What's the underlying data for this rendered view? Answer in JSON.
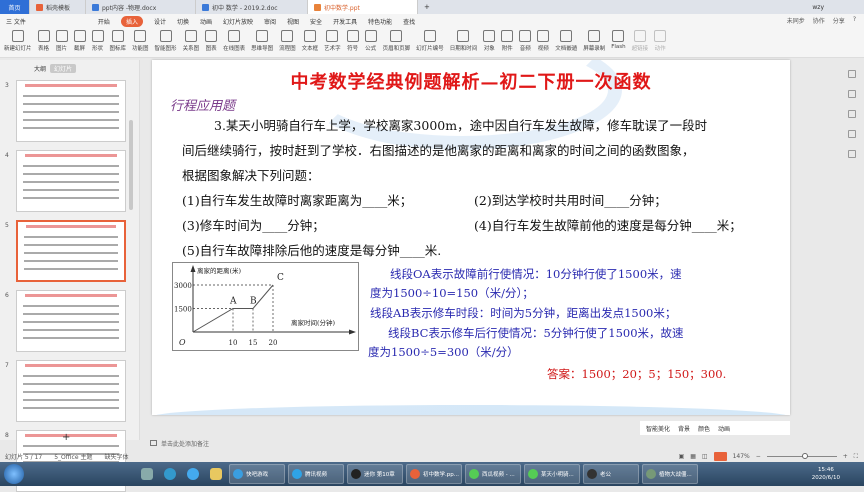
{
  "tabs": [
    {
      "label": "首页"
    },
    {
      "label": "稻壳模板"
    },
    {
      "label": "ppt内容 -物理.docx"
    },
    {
      "label": "初中 数学 - 2019.2.doc"
    },
    {
      "label": "初中数学.ppt",
      "active": true
    }
  ],
  "user": "wzy",
  "menu": [
    "三 文件",
    "开始",
    "插入",
    "设计",
    "切换",
    "动画",
    "幻灯片放映",
    "审阅",
    "视图",
    "安全",
    "开发工具",
    "特色功能",
    "查找"
  ],
  "menu_selected": "插入",
  "menu_right": [
    "未同步",
    "协作",
    "分享",
    "?"
  ],
  "ribbon": [
    "新建幻灯片",
    "表格",
    "图片",
    "截屏",
    "形状",
    "图标库",
    "功能图",
    "智能图形",
    "关系图",
    "图表",
    "在线图表",
    "思维导图",
    "流程图",
    "文本框",
    "艺术字",
    "符号",
    "公式",
    "页眉和页脚",
    "幻灯片编号",
    "日期和时间",
    "对象",
    "附件",
    "音频",
    "视频",
    "文档嵌遁",
    "屏幕录制",
    "Flash",
    "超链接",
    "动作"
  ],
  "left_panel": {
    "tabs": [
      "大纲",
      "幻灯片"
    ],
    "slide_numbers": [
      "3",
      "4",
      "5",
      "6",
      "7",
      "8"
    ],
    "current": "5",
    "add_label": "+"
  },
  "slide": {
    "title": "中考数学经典例题解析—初二下册一次函数",
    "subtitle": "行程应用题",
    "lines": [
      "3.某天小明骑自行车上学，学校离家3000m，途中因自行车发生故障，修车耽误了一段时",
      "间后继续骑行，按时赶到了学校．右图描述的是他离家的距离和离家的时间之间的函数图象，",
      "根据图象解决下列问题："
    ],
    "q1": "(1)自行车发生故障时离家距离为____米；",
    "q2": "(2)到达学校时共用时间____分钟；",
    "q3": "(3)修车时间为____分钟；",
    "q4": "(4)自行车发生故障前他的速度是每分钟____米；",
    "q5": "(5)自行车故障排除后他的速度是每分钟____米.",
    "explain": [
      "线段OA表示故障前行使情况：10分钟行使了1500米，速",
      "度为1500÷10=150（米/分）；",
      "线段AB表示修车时段：时间为5分钟，距离出发点1500米；",
      "线段BC表示修车后行使情况：5分钟行使了1500米，故速",
      "度为1500÷5=300（米/分）"
    ],
    "answer": "答案：1500；20；5；150；300."
  },
  "chart_data": {
    "type": "line",
    "ylabel": "离家的距离(米)",
    "xlabel": "离家时间(分钟)",
    "origin_label": "O",
    "x_ticks": [
      "10",
      "15",
      "20"
    ],
    "y_ticks": [
      "1500",
      "3000"
    ],
    "points": [
      {
        "label": "",
        "x": 0,
        "y": 0
      },
      {
        "label": "A",
        "x": 10,
        "y": 1500
      },
      {
        "label": "B",
        "x": 15,
        "y": 1500
      },
      {
        "label": "C",
        "x": 20,
        "y": 3000
      }
    ]
  },
  "slide_tools": [
    "智能美化",
    "背景",
    "颜色",
    "动画"
  ],
  "notes_placeholder": "单击此处添加备注",
  "status": {
    "slide": "幻灯片 5 / 17",
    "theme": "5_Office 主题",
    "font": "缺失字体",
    "zoom": "147%"
  },
  "taskbar": {
    "tasks": [
      "快吧游戏",
      "腾讯视频",
      "迷你 第10章",
      "初中数学.pp...",
      "西瓜视频 - ...",
      "某天小明骑...",
      "老公",
      "植物大战僵..."
    ],
    "time": "15:46",
    "date": "2020/6/10"
  }
}
